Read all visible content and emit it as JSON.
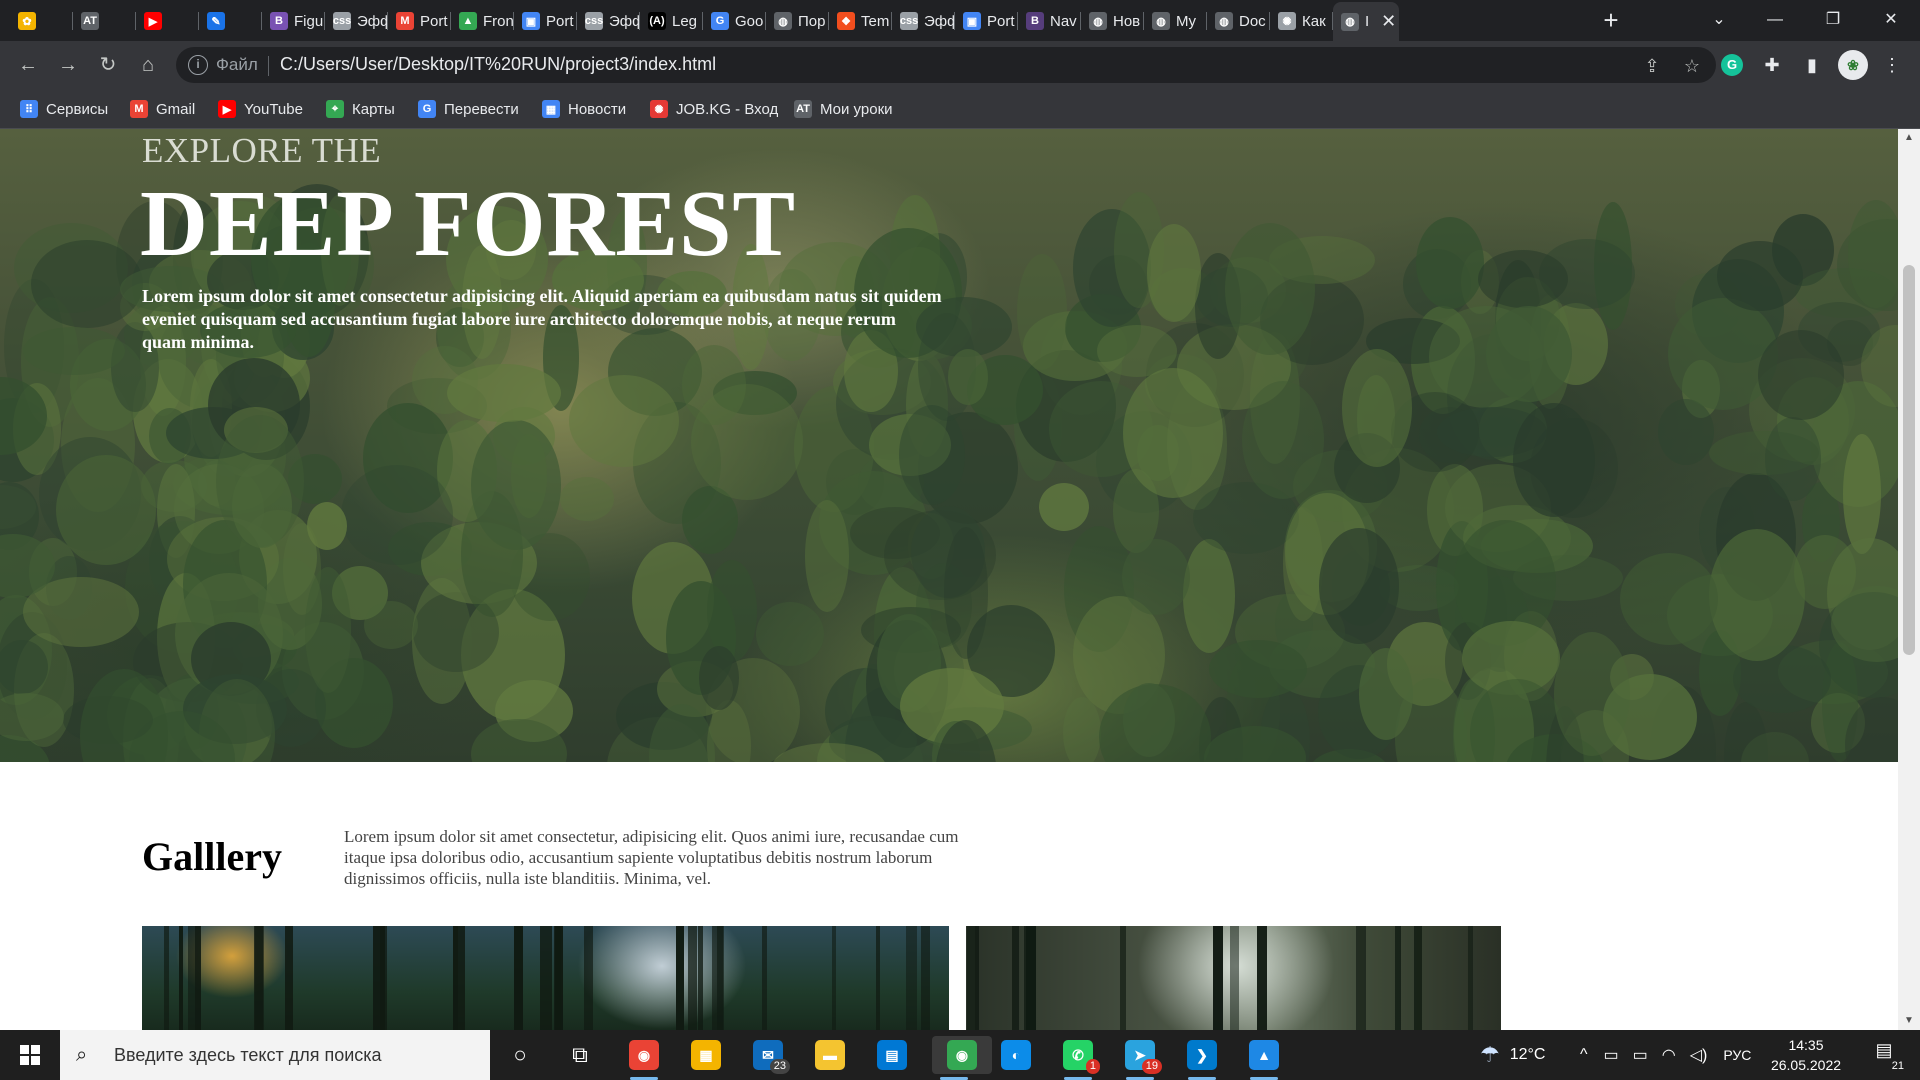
{
  "browser": {
    "tabs": [
      {
        "title": "",
        "icon": "sticker-favicon-icon",
        "color": "#f4b400",
        "glyph": "✿"
      },
      {
        "title": "",
        "icon": "at-favicon-icon",
        "color": "#5f6368",
        "glyph": "AT"
      },
      {
        "title": "",
        "icon": "youtube-favicon-icon",
        "color": "#ff0000",
        "glyph": "▶"
      },
      {
        "title": "",
        "icon": "edit-favicon-icon",
        "color": "#1a73e8",
        "glyph": "✎"
      },
      {
        "title": "Figu",
        "icon": "bootstrap-favicon-icon",
        "color": "#7952b3",
        "glyph": "B"
      },
      {
        "title": "Эфф",
        "icon": "css-favicon-icon",
        "color": "#9aa0a6",
        "glyph": "css"
      },
      {
        "title": "Port",
        "icon": "gmail-favicon-icon",
        "color": "#ea4335",
        "glyph": "M"
      },
      {
        "title": "Fron",
        "icon": "drive-favicon-icon",
        "color": "#34a853",
        "glyph": "▲"
      },
      {
        "title": "Port",
        "icon": "classroom-favicon-icon",
        "color": "#4285f4",
        "glyph": "▣"
      },
      {
        "title": "Эфф",
        "icon": "css-favicon-icon",
        "color": "#9aa0a6",
        "glyph": "css"
      },
      {
        "title": "Leg",
        "icon": "lego-favicon-icon",
        "color": "#000000",
        "glyph": "(A)"
      },
      {
        "title": "Goo",
        "icon": "translate-favicon-icon",
        "color": "#4285f4",
        "glyph": "G"
      },
      {
        "title": "Пор",
        "icon": "globe-favicon-icon",
        "color": "#5f6368",
        "glyph": "◍"
      },
      {
        "title": "Tem",
        "icon": "figma-favicon-icon",
        "color": "#f24e1e",
        "glyph": "❖"
      },
      {
        "title": "Эфф",
        "icon": "css-favicon-icon",
        "color": "#9aa0a6",
        "glyph": "css"
      },
      {
        "title": "Port",
        "icon": "classroom-favicon-icon",
        "color": "#4285f4",
        "glyph": "▣"
      },
      {
        "title": "Nav",
        "icon": "bootstrap-favicon-icon",
        "color": "#563d7c",
        "glyph": "B"
      },
      {
        "title": "Нов",
        "icon": "chrome-favicon-icon",
        "color": "#5f6368",
        "glyph": "◍"
      },
      {
        "title": "My",
        "icon": "globe-favicon-icon",
        "color": "#5f6368",
        "glyph": "◍"
      },
      {
        "title": "Doc",
        "icon": "globe-favicon-icon",
        "color": "#5f6368",
        "glyph": "◍"
      },
      {
        "title": "Как",
        "icon": "loading-favicon-icon",
        "color": "#9aa0a6",
        "glyph": "✺"
      },
      {
        "title": "I",
        "icon": "globe-favicon-icon",
        "color": "#5f6368",
        "glyph": "◍",
        "active": true
      }
    ],
    "close_tab_glyph": "✕",
    "new_tab_glyph": "+",
    "tab_search_glyph": "⌄",
    "window_controls": {
      "minimize": "—",
      "restore": "❐",
      "close": "✕"
    },
    "toolbar": {
      "back": "←",
      "forward": "→",
      "reload": "↻",
      "home": "⌂",
      "info_glyph": "i",
      "file_label": "Файл",
      "url": "C:/Users/User/Desktop/IT%20RUN/project3/index.html",
      "share_glyph": "⇪",
      "star_glyph": "☆",
      "grammarly_glyph": "G",
      "extensions_glyph": "✚",
      "sidepanel_glyph": "▮",
      "avatar_glyph": "❀",
      "menu_glyph": "⋮"
    },
    "bookmarks": [
      {
        "label": "Сервисы",
        "icon": "apps-grid-icon",
        "color": "#4285f4",
        "glyph": "⠿"
      },
      {
        "label": "Gmail",
        "icon": "gmail-icon",
        "color": "#ea4335",
        "glyph": "M"
      },
      {
        "label": "YouTube",
        "icon": "youtube-icon",
        "color": "#ff0000",
        "glyph": "▶"
      },
      {
        "label": "Карты",
        "icon": "maps-icon",
        "color": "#34a853",
        "glyph": "⌖"
      },
      {
        "label": "Перевести",
        "icon": "translate-icon",
        "color": "#4285f4",
        "glyph": "G"
      },
      {
        "label": "Новости",
        "icon": "news-icon",
        "color": "#4285f4",
        "glyph": "▦"
      },
      {
        "label": "JOB.KG - Вход",
        "icon": "jobkg-icon",
        "color": "#e53935",
        "glyph": "✺"
      },
      {
        "label": "Мои уроки",
        "icon": "at-icon",
        "color": "#5f6368",
        "glyph": "AT"
      }
    ]
  },
  "page": {
    "hero": {
      "subtitle": "EXPLORE THE",
      "title": "DEEP FOREST",
      "text": "Lorem ipsum dolor sit amet consectetur adipisicing elit. Aliquid aperiam ea quibusdam natus sit quidem eveniet quisquam sed accusantium fugiat labore iure architecto doloremque nobis, at neque rerum quam minima."
    },
    "gallery": {
      "title": "Galllery",
      "text": "Lorem ipsum dolor sit amet consectetur, adipisicing elit. Quos animi iure, recusandae cum itaque ipsa doloribus odio, accusantium sapiente voluptatibus debitis nostrum laborum dignissimos officiis, nulla iste blanditiis. Minima, vel."
    }
  },
  "scrollbar": {
    "up": "▲",
    "down": "▼"
  },
  "taskbar": {
    "search_placeholder": "Введите здесь текст для поиска",
    "search_glyph": "⌕",
    "apps": [
      {
        "name": "cortana-icon",
        "glyph": "○",
        "color": "transparent",
        "badge": ""
      },
      {
        "name": "task-view-icon",
        "glyph": "⧉",
        "color": "transparent",
        "badge": ""
      },
      {
        "name": "chrome-icon",
        "glyph": "◉",
        "color": "#ea4335",
        "badge": "",
        "underline": true
      },
      {
        "name": "store-icon",
        "glyph": "▦",
        "color": "#f4b400",
        "badge": ""
      },
      {
        "name": "mail-icon",
        "glyph": "✉",
        "color": "#0f6cbd",
        "badge": "23"
      },
      {
        "name": "explorer-icon",
        "glyph": "▬",
        "color": "#f4c430",
        "badge": ""
      },
      {
        "name": "notes-icon",
        "glyph": "▤",
        "color": "#0078d4",
        "badge": ""
      },
      {
        "name": "chrome-active-icon",
        "glyph": "◉",
        "color": "#34a853",
        "badge": "",
        "active": true,
        "underline": true
      },
      {
        "name": "edge-icon",
        "glyph": "◐",
        "color": "#0c8ce9",
        "badge": ""
      },
      {
        "name": "whatsapp-icon",
        "glyph": "✆",
        "color": "#25d366",
        "badge": "1",
        "red": true,
        "underline": true
      },
      {
        "name": "telegram-icon",
        "glyph": "➤",
        "color": "#2aa3de",
        "badge": "19",
        "red": true,
        "underline": true
      },
      {
        "name": "vscode-icon",
        "glyph": "❯",
        "color": "#007acc",
        "badge": "",
        "underline": true
      },
      {
        "name": "photos-icon",
        "glyph": "▲",
        "color": "#1e88e5",
        "badge": "",
        "underline": true
      }
    ],
    "weather": {
      "glyph": "☂",
      "temp": "12°C"
    },
    "tray_glyphs": {
      "chevron": "^",
      "meet": "▭",
      "battery": "▭",
      "wifi": "◠",
      "volume": "◁)"
    },
    "lang": "РУС",
    "time": "14:35",
    "date": "26.05.2022",
    "notifications": {
      "glyph": "▤",
      "count": "21"
    }
  },
  "colors": {
    "hero_title": "#ffffff",
    "page_bg": "#ffffff",
    "chrome_dark": "#202124"
  }
}
